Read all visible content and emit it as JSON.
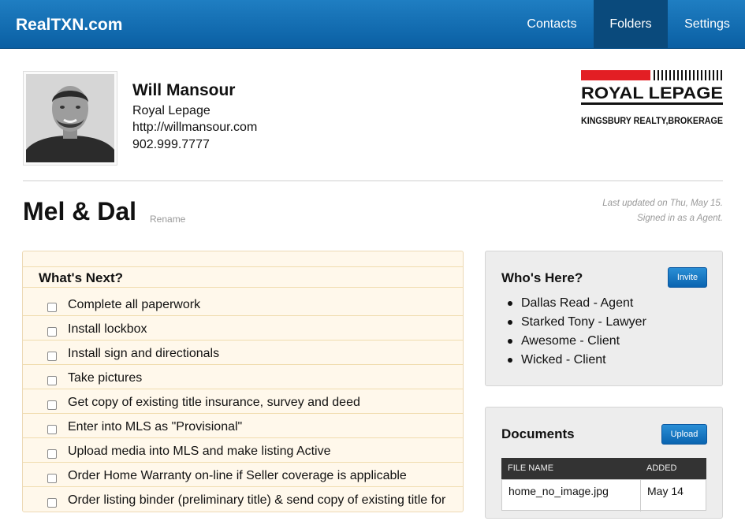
{
  "navbar": {
    "brand": "RealTXN.com",
    "items": [
      "Contacts",
      "Folders",
      "Settings"
    ],
    "active": "Folders"
  },
  "agent": {
    "name": "Will Mansour",
    "company": "Royal Lepage",
    "website": "http://willmansour.com",
    "phone": "902.999.7777"
  },
  "logo": {
    "line1": "ROYAL LEPAGE",
    "line2": "KINGSBURY REALTY,BROKERAGE"
  },
  "folder": {
    "title": "Mel & Dal",
    "rename_label": "Rename",
    "last_updated": "Last updated on Thu, May 15.",
    "signed_in": "Signed in as a Agent."
  },
  "whats_next": {
    "title": "What's Next?",
    "items": [
      "Complete all paperwork",
      "Install lockbox",
      "Install sign and directionals",
      "Take pictures",
      "Get copy of existing title insurance, survey and deed",
      "Enter into MLS as \"Provisional\"",
      "Upload media into MLS and make listing Active",
      "Order Home Warranty on-line if Seller coverage is applicable",
      "Order listing binder (preliminary title) & send copy of existing title for"
    ]
  },
  "whos_here": {
    "title": "Who's Here?",
    "invite_label": "Invite",
    "members": [
      "Dallas Read - Agent",
      "Starked Tony - Lawyer",
      "Awesome - Client",
      "Wicked - Client"
    ]
  },
  "documents": {
    "title": "Documents",
    "upload_label": "Upload",
    "columns": [
      "FILE NAME",
      "ADDED"
    ],
    "rows": [
      {
        "file_name": "home_no_image.jpg",
        "added": "May 14"
      }
    ]
  },
  "colors": {
    "navbar": "#1f7ec2",
    "active_nav": "#0a4a7c",
    "notepad_bg": "#fff8eb",
    "panel_bg": "#ededed",
    "button_blue": "#1a7bc8",
    "logo_red": "#e31e24"
  }
}
